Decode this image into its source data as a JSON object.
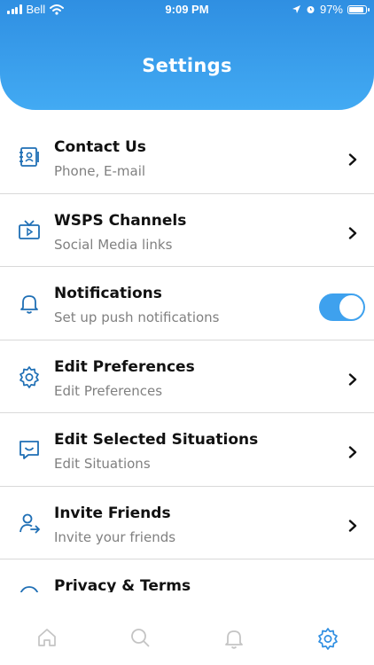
{
  "status": {
    "carrier": "Bell",
    "time": "9:09 PM",
    "battery": "97%",
    "battery_level": 0.97
  },
  "header": {
    "title": "Settings"
  },
  "settings": [
    {
      "title": "Contact Us",
      "subtitle": "Phone, E-mail",
      "icon": "contact-book-icon",
      "control": "chevron"
    },
    {
      "title": "WSPS Channels",
      "subtitle": "Social Media links",
      "icon": "tv-icon",
      "control": "chevron"
    },
    {
      "title": "Notifications",
      "subtitle": "Set up push notifications",
      "icon": "bell-icon",
      "control": "toggle",
      "toggle_on": true
    },
    {
      "title": "Edit Preferences",
      "subtitle": "Edit Preferences",
      "icon": "gear-icon",
      "control": "chevron"
    },
    {
      "title": "Edit Selected Situations",
      "subtitle": "Edit Situations",
      "icon": "message-smile-icon",
      "control": "chevron"
    },
    {
      "title": "Invite Friends",
      "subtitle": "Invite your friends",
      "icon": "invite-user-icon",
      "control": "chevron"
    },
    {
      "title": "Privacy & Terms",
      "subtitle": "",
      "icon": "privacy-icon",
      "control": "chevron"
    }
  ],
  "tabbar": [
    {
      "icon": "home-icon",
      "active": false
    },
    {
      "icon": "search-icon",
      "active": false
    },
    {
      "icon": "bell-icon",
      "active": false
    },
    {
      "icon": "gear-icon",
      "active": true
    }
  ],
  "colors": {
    "accent": "#2f8fe2",
    "icon": "#1f6fb5",
    "tab_inactive": "#c4c4c4",
    "subtitle": "#808080",
    "divider": "#d9d9d9"
  }
}
